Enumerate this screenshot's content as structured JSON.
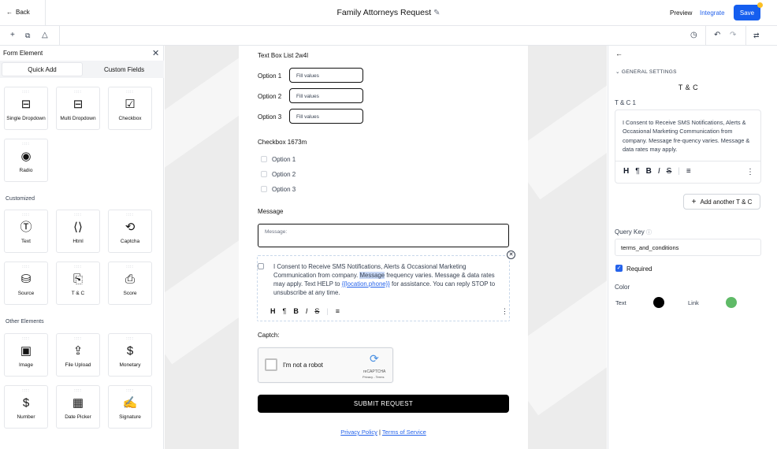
{
  "topbar": {
    "back_label": "Back",
    "title": "Family Attorneys Request",
    "preview_label": "Preview",
    "integrate_label": "Integrate",
    "save_label": "Save"
  },
  "left_panel": {
    "title": "Form Element",
    "tabs": [
      "Quick Add",
      "Custom Fields"
    ],
    "quick_add": [
      {
        "label": "Single Dropdown",
        "icon": "dropdown-icon"
      },
      {
        "label": "Multi Dropdown",
        "icon": "multi-dropdown-icon"
      },
      {
        "label": "Checkbox",
        "icon": "checkbox-icon"
      },
      {
        "label": "Radio",
        "icon": "radio-icon"
      }
    ],
    "customized_title": "Customized",
    "customized": [
      {
        "label": "Text",
        "icon": "text-icon"
      },
      {
        "label": "Html",
        "icon": "html-icon"
      },
      {
        "label": "Captcha",
        "icon": "captcha-icon"
      },
      {
        "label": "Source",
        "icon": "source-icon"
      },
      {
        "label": "T & C",
        "icon": "terms-icon"
      },
      {
        "label": "Score",
        "icon": "score-icon"
      }
    ],
    "other_title": "Other Elements",
    "other": [
      {
        "label": "Image",
        "icon": "image-icon"
      },
      {
        "label": "File Upload",
        "icon": "file-upload-icon"
      },
      {
        "label": "Monetary",
        "icon": "monetary-icon"
      },
      {
        "label": "Number",
        "icon": "number-icon"
      },
      {
        "label": "Date Picker",
        "icon": "date-picker-icon"
      },
      {
        "label": "Signature",
        "icon": "signature-icon"
      }
    ]
  },
  "form": {
    "textbox_list_label": "Text Box List 2w4l",
    "textbox_options": [
      {
        "label": "Option 1",
        "placeholder": "Fill values"
      },
      {
        "label": "Option 2",
        "placeholder": "Fill values"
      },
      {
        "label": "Option 3",
        "placeholder": "Fill values"
      }
    ],
    "checkbox_label": "Checkbox 1673m",
    "checkbox_options": [
      "Option 1",
      "Option 2",
      "Option 3"
    ],
    "message_label": "Message",
    "message_placeholder": "Message:",
    "tc_text_1": "I Consent to Receive SMS Notifications, Alerts & Occasional Marketing Communication from company. ",
    "tc_highlight": "Message",
    "tc_text_2": " frequency varies. Message & data rates may apply. Text HELP to ",
    "tc_link": "{{location.phone}}",
    "tc_text_3": " for assistance. You can reply STOP to unsubscribe at any time.",
    "captcha_label": "Captch:",
    "captcha_text": "I'm not a robot",
    "captcha_brand": "reCAPTCHA",
    "captcha_terms": "Privacy - Terms",
    "submit_label": "SUBMIT REQUEST",
    "privacy_link": "Privacy Policy",
    "footer_separator": "|",
    "terms_link": "Terms of Service"
  },
  "right_panel": {
    "section": "GENERAL SETTINGS",
    "heading": "T & C",
    "field_label": "T & C 1",
    "editor_text": "I Consent to Receive SMS Notifications, Alerts & Occasional Marketing Communication from company. Message fre-quency varies. Message & data rates may apply.",
    "add_label": "Add another T & C",
    "query_key_label": "Query Key",
    "query_key_value": "terms_and_conditions",
    "required_label": "Required",
    "color_label": "Color",
    "text_color_label": "Text",
    "link_color_label": "Link",
    "text_color": "#000000",
    "link_color": "#5fba67"
  },
  "accent_color": "#155eef"
}
